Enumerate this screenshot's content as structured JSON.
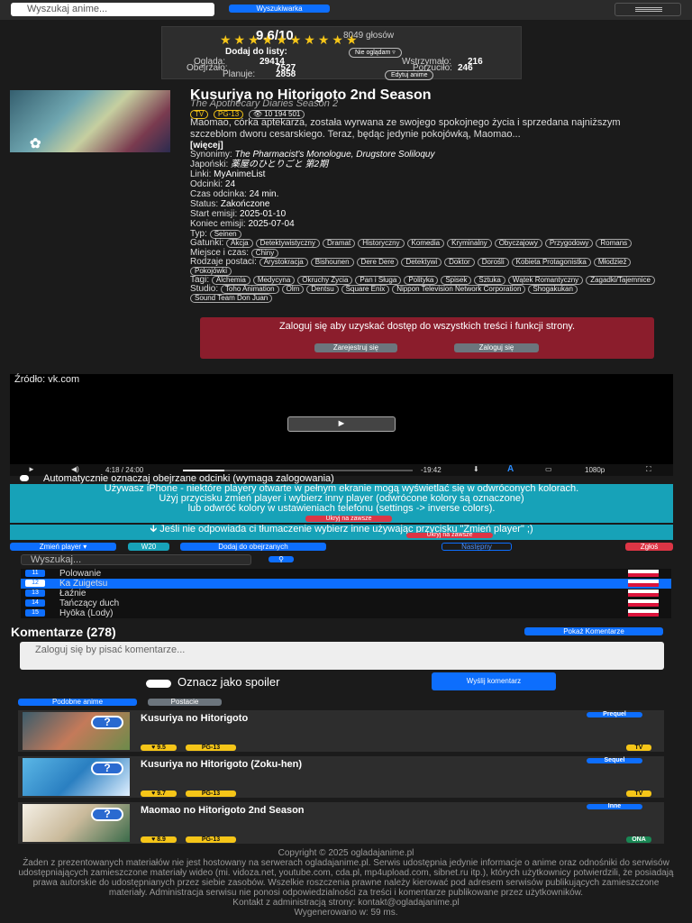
{
  "topbar": {
    "search_placeholder": "Wyszukaj anime...",
    "search_button": "Wyszukiwarka"
  },
  "rating": {
    "score": "9.6/10",
    "votes": "8049 głosów",
    "stars": "★★★★★★★★★★",
    "add_to_list_label": "Dodaj do listy:",
    "list_status": "Nie oglądam",
    "watching_label": "Ogląda:",
    "watching_value": "29414",
    "paused_label": "Wstrzymało:",
    "paused_value": "216",
    "completed_label": "Obejrzało:",
    "completed_value": "7527",
    "dropped_label": "Porzuciło:",
    "dropped_value": "246",
    "planning_label": "Planuje:",
    "planning_value": "2858",
    "edit_button": "Edytuj anime"
  },
  "anime": {
    "title": "Kusuriya no Hitorigoto 2nd Season",
    "alt_title": "The Apothecary Diaries Season 2",
    "badge_type": "TV",
    "badge_rating": "PG-13",
    "badge_views": "👁 10 194 501",
    "description": "Maomao, córka aptekarza, została wyrwana ze swojego spokojnego życia i sprzedana najniższym szczeblom dworu cesarskiego. Teraz, będąc jedynie pokojówką, Maomao...",
    "more": "[więcej]",
    "synonyms_label": "Synonimy:",
    "synonyms": "The Pharmacist's Monologue, Drugstore Soliloquy",
    "japanese_label": "Japoński:",
    "japanese": "薬屋のひとりごと 第2期",
    "links_label": "Linki:",
    "links": "MyAnimeList",
    "episodes_label": "Odcinki:",
    "episodes": "24",
    "duration_label": "Czas odcinka:",
    "duration": "24 min.",
    "status_label": "Status:",
    "status": "Zakończone",
    "start_label": "Start emisji:",
    "start": "2025-01-10",
    "end_label": "Koniec emisji:",
    "end": "2025-07-04",
    "type_label": "Typ:",
    "type": "Seinen",
    "genres_label": "Gatunki:",
    "genres": [
      "Akcja",
      "Detektywistyczny",
      "Dramat",
      "Historyczny",
      "Komedia",
      "Kryminalny",
      "Obyczajowy",
      "Przygodowy",
      "Romans"
    ],
    "places_label": "Miejsce i czas:",
    "places": [
      "Chiny"
    ],
    "characters_label": "Rodzaje postaci:",
    "characters": [
      "Arystokracja",
      "Bishounen",
      "Dere Dere",
      "Detektywi",
      "Doktor",
      "Dorośli",
      "Kobieta Protagonistka",
      "Młodzież",
      "Pokojówki"
    ],
    "tags_label": "Tagi:",
    "tags": [
      "Alchemia",
      "Medycyna",
      "Okruchy Życia",
      "Pan i Sługa",
      "Polityka",
      "Spisek",
      "Sztuka",
      "Wątek Romantyczny",
      "Zagadki/Tajemnice"
    ],
    "studio_label": "Studio:",
    "studios": [
      "Toho Animation",
      "Olm",
      "Dentsu",
      "Square Enix",
      "Nippon Television Network Corporation",
      "Shogakukan",
      "Sound Team Don Juan"
    ]
  },
  "login_box": {
    "text": "Zaloguj się aby uzyskać dostęp do wszystkich treści i funkcji strony.",
    "register": "Zarejestruj się",
    "login": "Zaloguj się"
  },
  "player": {
    "source": "Źródło: vk.com",
    "time": "4:18 / 24:00",
    "remaining": "-19:42",
    "quality": "1080p"
  },
  "auto_mark": "Automatycznie oznaczaj obejrzane odcinki (wymaga zalogowania)",
  "iphone_notice": {
    "line1": "Używasz iPhone - niektóre playery otwarte w pełnym ekranie mogą wyświetlać się w odwróconych kolorach.",
    "line2": "Użyj przycisku zmień player i wybierz inny player (odwrócone kolory są oznaczone)",
    "line3": "lub odwróć kolory w ustawieniach telefonu (settings -> inverse colors).",
    "hide": "Ukryj na zawsze"
  },
  "translation_notice": {
    "text": "🡳 Jeśli nie odpowiada ci tłumaczenie wybierz inne używając przycisku \"Zmień player\" ;)",
    "hide": "Ukryj na zawsze"
  },
  "toolbar": {
    "change_player": "Zmień player ▾",
    "player_name": "W20",
    "add_watched": "Dodaj do obejrzanych",
    "next": "Następny",
    "report": "Zgłoś"
  },
  "episodes": {
    "search_placeholder": "Wyszukaj...",
    "items": [
      {
        "num": "11",
        "name": "Polowanie"
      },
      {
        "num": "12",
        "name": "Ka Zuigetsu"
      },
      {
        "num": "13",
        "name": "Łaźnie"
      },
      {
        "num": "14",
        "name": "Tańczący duch"
      },
      {
        "num": "15",
        "name": "Hyōka (Lody)"
      }
    ]
  },
  "comments": {
    "title": "Komentarze (278)",
    "show": "Pokaż Komentarze",
    "placeholder": "Zaloguj się by pisać komentarze...",
    "spoiler": "Oznacz jako spoiler",
    "send": "Wyślij komentarz"
  },
  "tabs": {
    "similar": "Podobne anime",
    "characters": "Postacie"
  },
  "similar": [
    {
      "title": "Kusuriya no Hitorigoto",
      "relation": "Prequel",
      "score": "9.5",
      "rating": "PG-13",
      "type": "TV"
    },
    {
      "title": "Kusuriya no Hitorigoto (Zoku-hen)",
      "relation": "Sequel",
      "score": "9.7",
      "rating": "PG-13",
      "type": "TV"
    },
    {
      "title": "Maomao no Hitorigoto 2nd Season",
      "relation": "Inne",
      "score": "8.9",
      "rating": "PG-13",
      "type": "ONA"
    }
  ],
  "footer": {
    "copyright": "Copyright © 2025 ogladajanime.pl",
    "disclaimer": "Żaden z prezentowanych materiałów nie jest hostowany na serwerach ogladajanime.pl. Serwis udostępnia jedynie informacje o anime oraz odnośniki do serwisów udostępniających zamieszczone materiały wideo (mi. vidoza.net, youtube.com, cda.pl, mp4upload.com, sibnet.ru itp.), których użytkownicy potwierdzili, że posiadają prawa autorskie do udostępnianych przez siebie zasobów. Wszelkie roszczenia prawne należy kierować pod adresem serwisów publikujących zamieszczone materiały. Administracja serwisu nie ponosi odpowiedzialności za treści i komentarze publikowane przez użytkowników.",
    "contact": "Kontakt z administracją strony: kontakt@ogladajanime.pl",
    "generated": "Wygenerowano w: 59 ms."
  },
  "colors": {
    "accent": "#0d6efd",
    "cyan": "#17a2b8",
    "danger": "#dc3545",
    "login_bg": "#8b1d2c",
    "star": "#f5c518"
  }
}
